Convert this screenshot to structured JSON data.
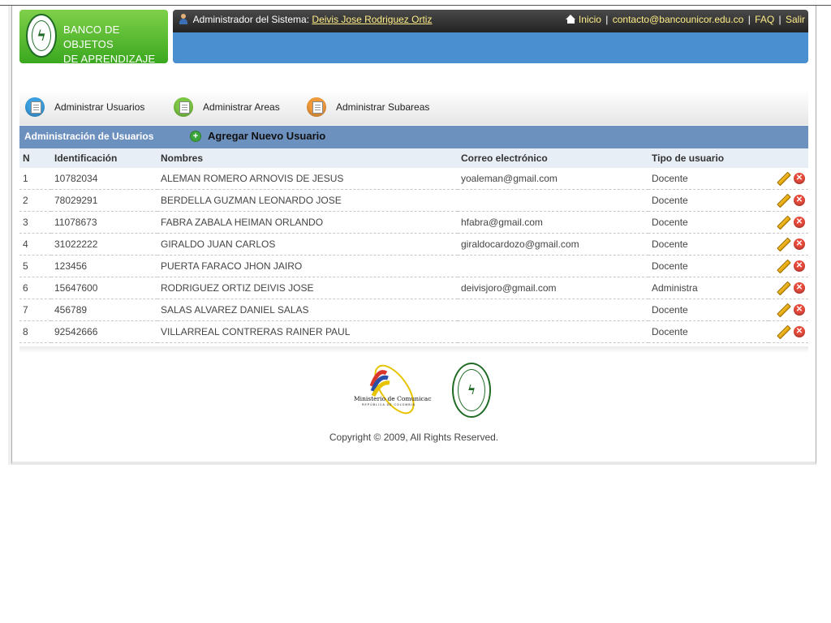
{
  "app": {
    "logo_line1": "BANCO DE OBJETOS",
    "logo_line2": "DE APRENDIZAJE"
  },
  "header": {
    "admin_prefix": "Administrador del Sistema:",
    "admin_name": "Deivis Jose Rodriguez Ortiz",
    "links": {
      "home": "Inicio",
      "contact": "contacto@bancounicor.edu.co",
      "faq": "FAQ",
      "logout": "Salir"
    },
    "separator": "|"
  },
  "menu": {
    "items": [
      {
        "label": "Administrar Usuarios",
        "icon": "users-icon",
        "color": "#3aa0e0"
      },
      {
        "label": "Administrar Areas",
        "icon": "areas-icon",
        "color": "#7cc742"
      },
      {
        "label": "Administrar Subareas",
        "icon": "subareas-icon",
        "color": "#f29a3a"
      }
    ]
  },
  "section": {
    "title": "Administración de Usuarios",
    "add_label": "Agregar Nuevo Usuario"
  },
  "table": {
    "headers": [
      "N",
      "Identificación",
      "Nombres",
      "Correo electrónico",
      "Tipo de usuario"
    ],
    "rows": [
      {
        "n": "1",
        "id": "10782034",
        "name": "ALEMAN ROMERO ARNOVIS DE JESUS",
        "email": "yoaleman@gmail.com",
        "type": "Docente"
      },
      {
        "n": "2",
        "id": "78029291",
        "name": "BERDELLA GUZMAN LEONARDO JOSE",
        "email": "",
        "type": "Docente"
      },
      {
        "n": "3",
        "id": "11078673",
        "name": "FABRA ZABALA HEIMAN ORLANDO",
        "email": "hfabra@gmail.com",
        "type": "Docente"
      },
      {
        "n": "4",
        "id": "31022222",
        "name": "GIRALDO JUAN CARLOS",
        "email": "giraldocardozo@gmail.com",
        "type": "Docente"
      },
      {
        "n": "5",
        "id": "123456",
        "name": "PUERTA FARACO JHON JAIRO",
        "email": "",
        "type": "Docente"
      },
      {
        "n": "6",
        "id": "15647600",
        "name": "RODRIGUEZ ORTIZ DEIVIS JOSE",
        "email": "deivisjoro@gmail.com",
        "type": "Administra"
      },
      {
        "n": "7",
        "id": "456789",
        "name": "SALAS ALVAREZ DANIEL SALAS",
        "email": "",
        "type": "Docente"
      },
      {
        "n": "8",
        "id": "92542666",
        "name": "VILLARREAL CONTRERAS RAINER PAUL",
        "email": "",
        "type": "Docente"
      }
    ]
  },
  "footer": {
    "mincom_text": "Ministerio de Comunicaciones",
    "mincom_sub": "REPÚBLICA DE COLOMBIA",
    "copyright": "Copyright © 2009, All Rights Reserved."
  }
}
